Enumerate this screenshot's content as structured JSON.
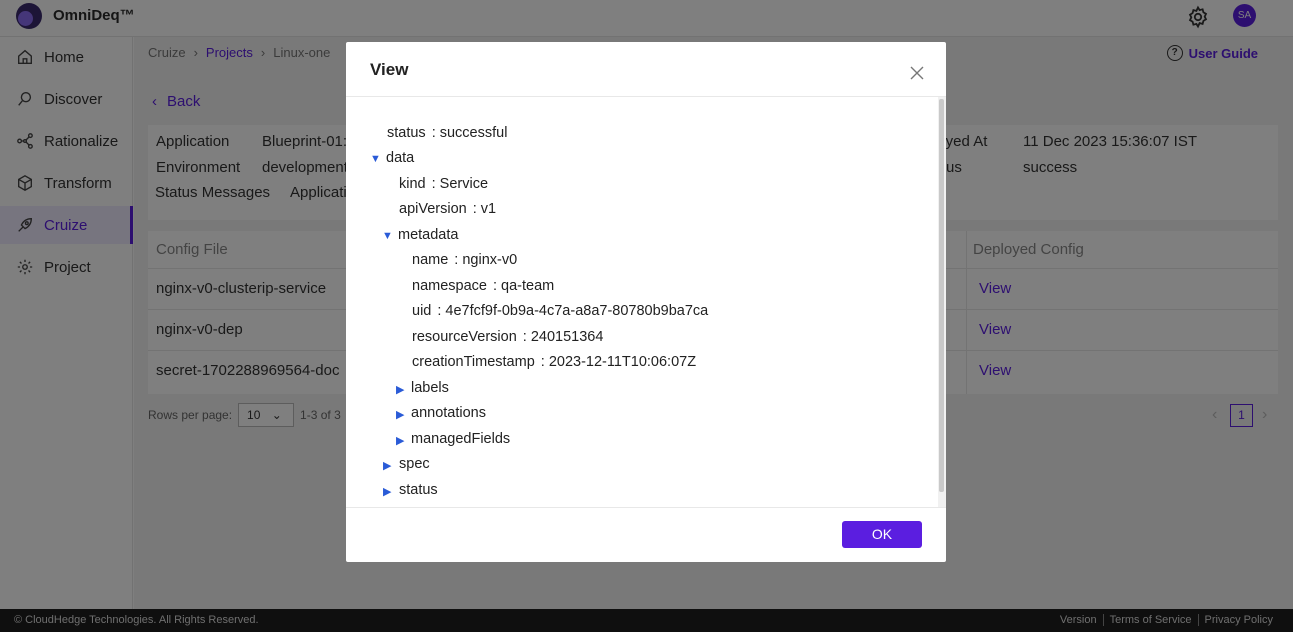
{
  "app": {
    "brand": "OmniDeq™",
    "avatar_initials": "SA",
    "accent": "#5b1ee0"
  },
  "sidebar": {
    "items": [
      {
        "label": "Home",
        "icon": "home-icon"
      },
      {
        "label": "Discover",
        "icon": "discover-icon"
      },
      {
        "label": "Rationalize",
        "icon": "rationalize-icon"
      },
      {
        "label": "Transform",
        "icon": "transform-icon"
      },
      {
        "label": "Cruize",
        "icon": "cruize-icon",
        "active": true
      },
      {
        "label": "Project",
        "icon": "project-gear-icon"
      }
    ]
  },
  "breadcrumb": [
    "Cruize",
    "Projects",
    "Linux-one"
  ],
  "user_guide": "User Guide",
  "back": "Back",
  "info": {
    "application_label": "Application",
    "application_value": "Blueprint-01:",
    "environment_label": "Environment",
    "environment_value": "development",
    "status_messages_label": "Status Messages",
    "status_messages_value": "Applicati",
    "deployed_at_label": "loyed At",
    "deployed_at_value": "11 Dec 2023 15:36:07 IST",
    "status_label": "us",
    "status_value": "success"
  },
  "table": {
    "headers": {
      "config_file": "Config File",
      "deployed_config": "Deployed Config"
    },
    "rows": [
      {
        "config_file": "nginx-v0-clusterip-service",
        "action": "View"
      },
      {
        "config_file": "nginx-v0-dep",
        "action": "View"
      },
      {
        "config_file": "secret-1702288969564-doc",
        "action": "View"
      }
    ]
  },
  "pager": {
    "rows_label": "Rows per page:",
    "rows_value": "10",
    "range": "1-3 of 3",
    "page": "1"
  },
  "footer": {
    "copyright": "© CloudHedge Technologies. All Rights Reserved.",
    "links": [
      "Version",
      "Terms of Service",
      "Privacy Policy"
    ]
  },
  "modal": {
    "title": "View",
    "ok": "OK",
    "tree": {
      "status_key": "status",
      "status_val": ": successful",
      "data_key": "data",
      "kind_key": "kind",
      "kind_val": ": Service",
      "apiVersion_key": "apiVersion",
      "apiVersion_val": ": v1",
      "metadata_key": "metadata",
      "name_key": "name",
      "name_val": ": nginx-v0",
      "namespace_key": "namespace",
      "namespace_val": ": qa-team",
      "uid_key": "uid",
      "uid_val": ": 4e7fcf9f-0b9a-4c7a-a8a7-80780b9ba7ca",
      "resourceVersion_key": "resourceVersion",
      "resourceVersion_val": ": 240151364",
      "creationTimestamp_key": "creationTimestamp",
      "creationTimestamp_val": ": 2023-12-11T10:06:07Z",
      "labels_key": "labels",
      "annotations_key": "annotations",
      "managedFields_key": "managedFields",
      "spec_key": "spec",
      "status2_key": "status",
      "expanded_marker": "▼",
      "collapsed_marker": "▶"
    }
  }
}
